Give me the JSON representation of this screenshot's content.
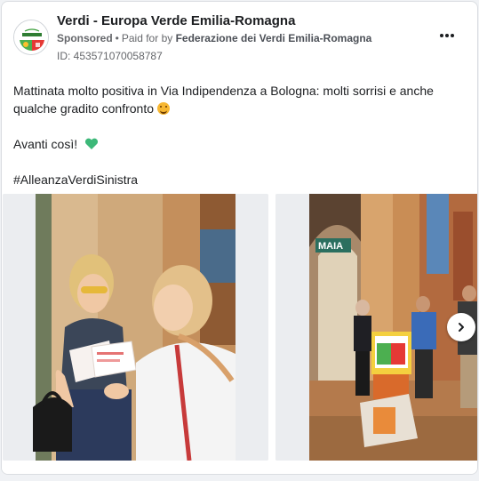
{
  "post": {
    "page_name": "Verdi - Europa Verde Emilia-Romagna",
    "sponsored": "Sponsored",
    "separator": "•",
    "paid_for_prefix": "Paid for by",
    "funder": "Federazione dei Verdi Emilia-Romagna",
    "ad_id": "ID: 453571070058787",
    "body_line1": "Mattinata molto positiva in Via Indipendenza a Bologna: molti sorrisi e anche qualche gradito confronto",
    "body_line2": "Avanti così!",
    "body_line3": "#AlleanzaVerdiSinistra"
  },
  "carousel": {
    "images": [
      {
        "alt": ""
      },
      {
        "alt": ""
      }
    ],
    "sign_text": "MAIA"
  },
  "colors": {
    "accent_green": "#3cb878",
    "text_primary": "#1c1e21",
    "text_secondary": "#65676b"
  },
  "icons": {
    "more": "more-options-icon",
    "next": "chevron-right-icon",
    "heart": "green-heart-icon",
    "smile": "smiling-face-icon"
  }
}
